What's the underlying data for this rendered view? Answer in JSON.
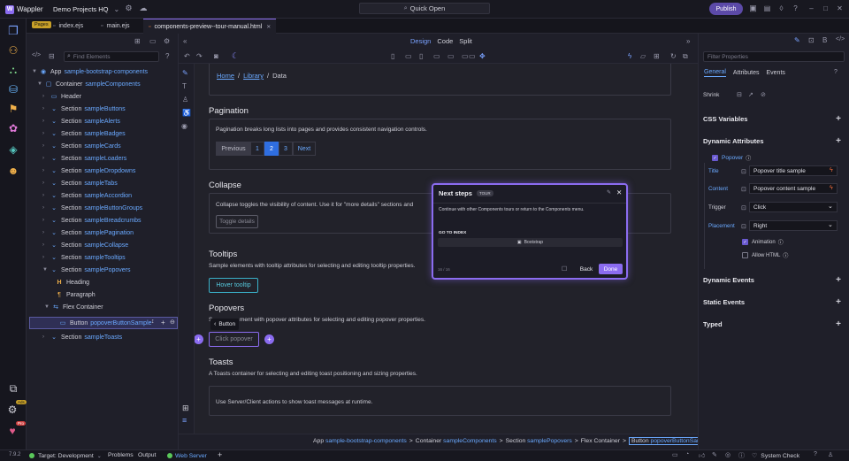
{
  "titlebar": {
    "app_name": "Wappler",
    "project": "Demo Projects HQ",
    "quick_open": "Quick Open",
    "publish": "Publish"
  },
  "tabs": {
    "pages_badge": "Pages",
    "items": [
      {
        "label": "index.ejs"
      },
      {
        "label": "main.ejs"
      },
      {
        "label": "components-preview--tour-manual.html"
      }
    ]
  },
  "nav": {
    "find_placeholder": "Find Elements",
    "tree": [
      {
        "kw": "App",
        "nm": "sample-bootstrap-components"
      },
      {
        "kw": "Container",
        "nm": "sampleComponents"
      },
      {
        "kw": "Header",
        "nm": ""
      },
      {
        "kw": "Section",
        "nm": "sampleButtons"
      },
      {
        "kw": "Section",
        "nm": "sampleAlerts"
      },
      {
        "kw": "Section",
        "nm": "sampleBadges"
      },
      {
        "kw": "Section",
        "nm": "sampleCards"
      },
      {
        "kw": "Section",
        "nm": "sampleLoaders"
      },
      {
        "kw": "Section",
        "nm": "sampleDropdowns"
      },
      {
        "kw": "Section",
        "nm": "sampleTabs"
      },
      {
        "kw": "Section",
        "nm": "sampleAccordion"
      },
      {
        "kw": "Section",
        "nm": "sampleButtonGroups"
      },
      {
        "kw": "Section",
        "nm": "sampleBreadcrumbs"
      },
      {
        "kw": "Section",
        "nm": "samplePagination"
      },
      {
        "kw": "Section",
        "nm": "sampleCollapse"
      },
      {
        "kw": "Section",
        "nm": "sampleTooltips"
      },
      {
        "kw": "Section",
        "nm": "samplePopovers"
      },
      {
        "kw": "Heading",
        "nm": ""
      },
      {
        "kw": "Paragraph",
        "nm": ""
      },
      {
        "kw": "Flex Container",
        "nm": ""
      },
      {
        "kw": "Button",
        "nm": "popoverButtonSample"
      },
      {
        "kw": "Section",
        "nm": "sampleToasts"
      }
    ]
  },
  "design": {
    "modes": [
      "Design",
      "Code",
      "Split"
    ]
  },
  "canvas": {
    "breadcrumb": [
      "Home",
      "Library",
      "Data"
    ],
    "pagination": {
      "title": "Pagination",
      "text": "Pagination breaks long lists into pages and provides consistent navigation controls.",
      "pages": [
        "Previous",
        "1",
        "2",
        "3",
        "Next"
      ]
    },
    "collapse": {
      "title": "Collapse",
      "text": "Collapse toggles the visibility of content. Use it for \"more details\" sections and",
      "button": "Toggle details"
    },
    "tooltips": {
      "title": "Tooltips",
      "text": "Sample elements with tooltip attributes for selecting and editing tooltip properties.",
      "button": "Hover tooltip"
    },
    "popovers": {
      "title": "Popovers",
      "text_start": "S",
      "text": "ment with popover attributes for selecting and editing popover properties.",
      "button": "Click popover",
      "tag": "Button"
    },
    "toasts": {
      "title": "Toasts",
      "text": "A Toasts container for selecting and editing toast positioning and sizing properties.",
      "card_text": "Use Server/Client actions to show toast messages at runtime."
    }
  },
  "tour": {
    "title": "Next steps",
    "badge": "TOUR",
    "body": "Continue with other Components tours or return to the Components menu.",
    "section": "GO TO INDEX",
    "link": "Bootstrap",
    "progress": "16 / 16",
    "back": "Back",
    "done": "Done"
  },
  "breadcrumb_bar": {
    "items": [
      {
        "kw": "App",
        "nm": "sample-bootstrap-components"
      },
      {
        "kw": "Container",
        "nm": "sampleComponents"
      },
      {
        "kw": "Section",
        "nm": "samplePopovers"
      },
      {
        "kw": "Flex Container",
        "nm": ""
      },
      {
        "kw": "Button",
        "nm": "popoverButtonSample"
      }
    ],
    "separator": ">"
  },
  "props": {
    "filter_placeholder": "Filter Properties",
    "tabs": [
      "General",
      "Attributes",
      "Events"
    ],
    "shrink": "Shrink",
    "css_variables": "CSS Variables",
    "dynamic_attributes": "Dynamic Attributes",
    "popover": "Popover",
    "fields": [
      {
        "label": "Title",
        "value": "Popover title sample"
      },
      {
        "label": "Content",
        "value": "Popover content sample"
      },
      {
        "label": "Trigger",
        "value": "Click"
      },
      {
        "label": "Placement",
        "value": "Right"
      }
    ],
    "animation": "Animation",
    "allow_html": "Allow HTML",
    "dynamic_events": "Dynamic Events",
    "static_events": "Static Events",
    "typed": "Typed"
  },
  "status": {
    "version": "7.9.2",
    "target": "Target: Development",
    "problems": "Problems",
    "output": "Output",
    "web_server": "Web Server",
    "system_check": "System Check",
    "settings_badge": "Ads",
    "pro_badge": "Pro"
  },
  "colors": {
    "accent": "#8b6cf0",
    "link": "#6aa9ff",
    "bg": "#1b1b24"
  }
}
